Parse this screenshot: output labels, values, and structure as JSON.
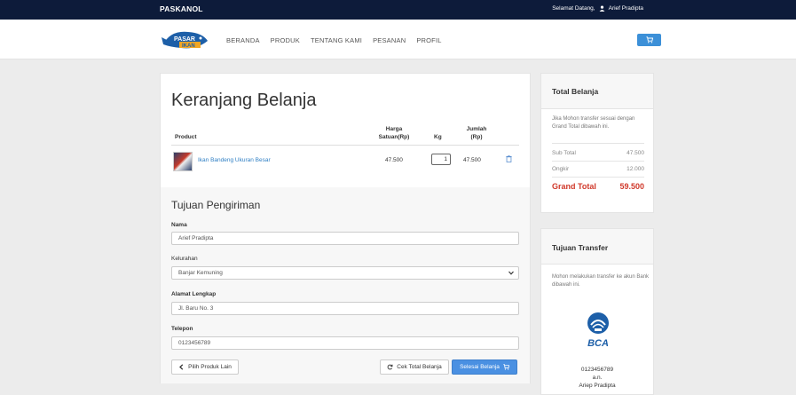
{
  "topbar": {
    "brand": "PASKANOL",
    "greeting": "Selamat Datang,",
    "user_name": "Arief Pradipta"
  },
  "navbar": {
    "logo_text": "PASAR IKAN",
    "links": [
      "BERANDA",
      "PRODUK",
      "TENTANG KAMI",
      "PESANAN",
      "PROFIL"
    ]
  },
  "cart": {
    "title": "Keranjang Belanja",
    "headers": {
      "product": "Product",
      "price_line1": "Harga",
      "price_line2": "Satuan(Rp)",
      "qty": "Kg",
      "total_line1": "Jumlah",
      "total_line2": "(Rp)"
    },
    "items": [
      {
        "name": "Ikan Bandeng Ukuran Besar",
        "price": "47.500",
        "qty": "1",
        "total": "47.500"
      }
    ]
  },
  "shipping": {
    "title": "Tujuan Pengiriman",
    "name_label": "Nama",
    "name_value": "Arief Pradipta",
    "kelurahan_label": "Kelurahan",
    "kelurahan_value": "Banjar Kemuning",
    "address_label": "Alamat Lengkap",
    "address_value": "Jl. Baru No. 3",
    "phone_label": "Telepon",
    "phone_value": "0123456789"
  },
  "buttons": {
    "back": "Pilih Produk Lain",
    "check_total": "Cek Total Belanja",
    "finish": "Selesai Belanja"
  },
  "summary": {
    "title": "Total Belanja",
    "note": "Jika Mohon transfer sesuai dengan Grand Total dibawah ini.",
    "subtotal_label": "Sub Total",
    "subtotal_value": "47.500",
    "shipping_label": "Ongkir",
    "shipping_value": "12.000",
    "grand_label": "Grand Total",
    "grand_value": "59.500"
  },
  "transfer": {
    "title": "Tujuan Transfer",
    "note": "Mohon melakukan transfer ke akun Bank dibawah ini.",
    "bank_name": "BCA",
    "account_number": "0123456789",
    "account_an": "a.n.",
    "account_holder": "Ariep Pradipta"
  },
  "colors": {
    "topbar": "#0d1b3a",
    "primary": "#4a90e2",
    "link": "#2f7fc4",
    "grand_total": "#d0392b"
  }
}
